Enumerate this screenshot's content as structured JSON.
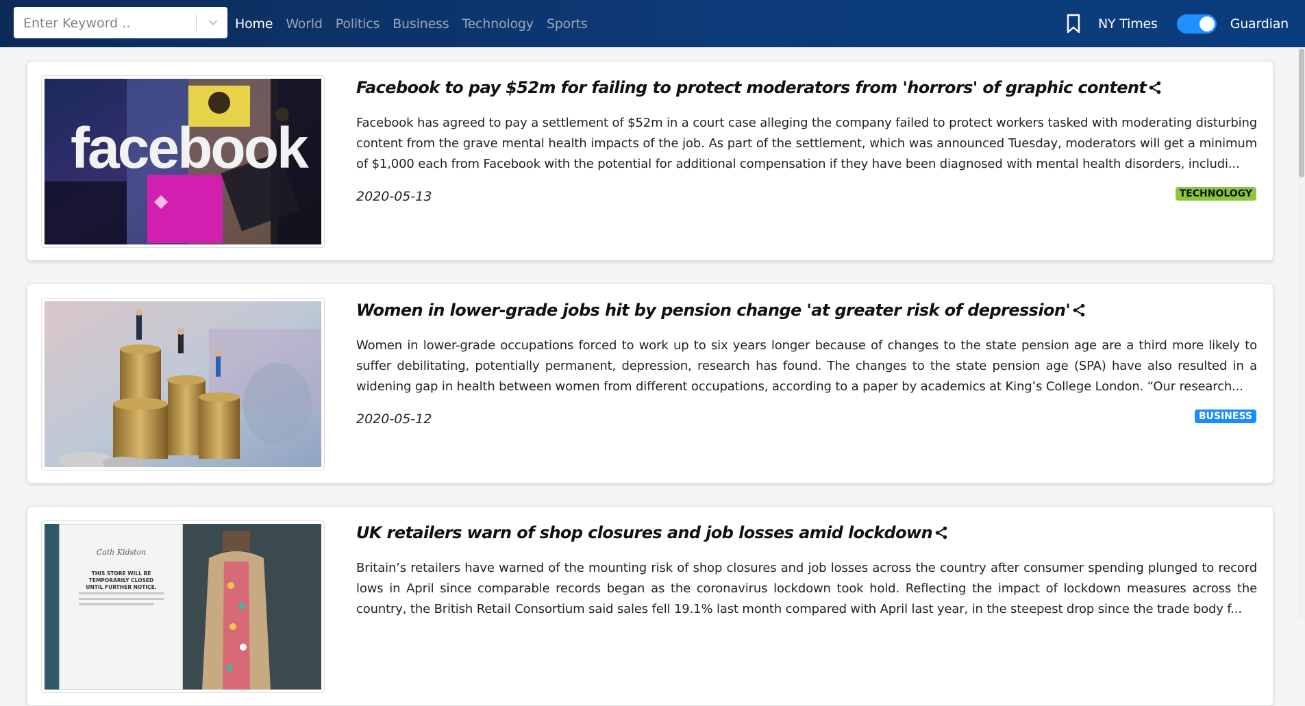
{
  "search": {
    "placeholder": "Enter Keyword .."
  },
  "nav": {
    "links": [
      "Home",
      "World",
      "Politics",
      "Business",
      "Technology",
      "Sports"
    ],
    "active": "Home"
  },
  "sources": {
    "left": "NY Times",
    "right": "Guardian",
    "toggle_on": true
  },
  "articles": [
    {
      "title": "Facebook to pay $52m for failing to protect moderators from 'horrors' of graphic content",
      "description": "Facebook has agreed to pay a settlement of $52m in a court case alleging the company failed to protect workers tasked with moderating disturbing content from the grave mental health impacts of the job. As part of the settlement, which was announced Tuesday, moderators will get a minimum of $1,000 each from Facebook with the potential for additional compensation if they have been diagnosed with mental health disorders, includi...",
      "date": "2020-05-13",
      "section": "TECHNOLOGY",
      "section_bg": "#8cc63f",
      "section_fg": "#111111",
      "image_text": "facebook"
    },
    {
      "title": "Women in lower-grade jobs hit by pension change 'at greater risk of depression'",
      "description": "Women in lower-grade occupations forced to work up to six years longer because of changes to the state pension age are a third more likely to suffer debilitating, potentially permanent, depression, research has found. The changes to the state pension age (SPA) have also resulted in a widening gap in health between women from different occupations, according to a paper by academics at King’s College London. “Our research...",
      "date": "2020-05-12",
      "section": "BUSINESS",
      "section_bg": "#1a8cff",
      "section_fg": "#ffffff"
    },
    {
      "title": "UK retailers warn of shop closures and job losses amid lockdown",
      "description": "Britain’s retailers have warned of the mounting risk of shop closures and job losses across the country after consumer spending plunged to record lows in April since comparable records began as the coronavirus lockdown took hold. Reflecting the impact of lockdown measures across the country, the British Retail Consortium said sales fell 19.1% last month compared with April last year, in the steepest drop since the trade body f...",
      "date": "",
      "section": "",
      "image_sign_brand": "Cath Kidston",
      "image_sign_text": "THIS STORE WILL BE TEMPORARILY CLOSED UNTIL FURTHER NOTICE."
    }
  ]
}
